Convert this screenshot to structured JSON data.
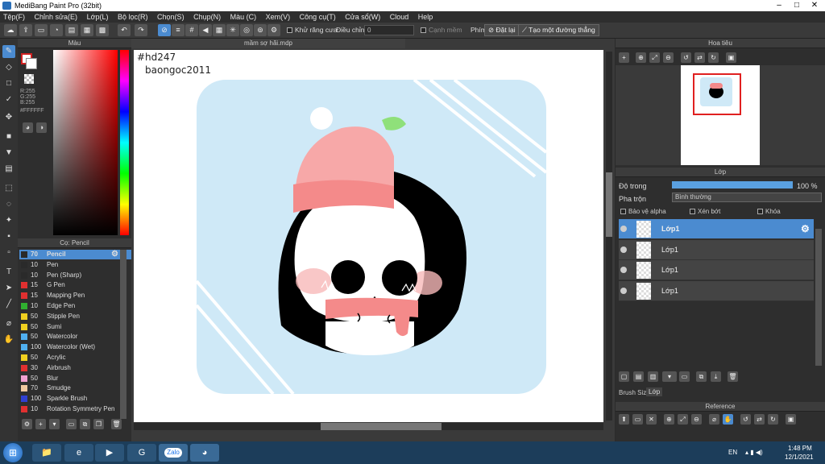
{
  "window": {
    "title": "MediBang Paint Pro (32bit)"
  },
  "menu": [
    "Tệp(F)",
    "Chỉnh sửa(E)",
    "Lớp(L)",
    "Bộ lọc(R)",
    "Chọn(S)",
    "Chụp(N)",
    "Màu (C)",
    "Xem(V)",
    "Công cụ(T)",
    "Cửa sổ(W)",
    "Cloud",
    "Help"
  ],
  "toolbar": {
    "antialias_label": "Khử răng cưa",
    "correction_label": "Điều chỉnh",
    "correction_value": "0",
    "sharp_label": "Cạnh mềm",
    "key_label": "Phím",
    "reset_label": "Đặt lại",
    "straight_label": "Tạo một đường thẳng"
  },
  "color_panel": {
    "title": "Màu",
    "r": "R:255",
    "g": "G:255",
    "b": "B:255",
    "hex": "#FFFFFF"
  },
  "brush_panel": {
    "title": "Cọ: Pencil",
    "items": [
      {
        "size": "70",
        "name": "Pencil",
        "color": "#2a2a2a"
      },
      {
        "size": "10",
        "name": "Pen",
        "color": "#2a2a2a"
      },
      {
        "size": "10",
        "name": "Pen (Sharp)",
        "color": "#2a2a2a"
      },
      {
        "size": "15",
        "name": "G Pen",
        "color": "#e03030"
      },
      {
        "size": "15",
        "name": "Mapping Pen",
        "color": "#e03030"
      },
      {
        "size": "10",
        "name": "Edge Pen",
        "color": "#30b030"
      },
      {
        "size": "50",
        "name": "Stipple Pen",
        "color": "#f0d020"
      },
      {
        "size": "50",
        "name": "Sumi",
        "color": "#f0d020"
      },
      {
        "size": "50",
        "name": "Watercolor",
        "color": "#50b0f0"
      },
      {
        "size": "100",
        "name": "Watercolor (Wet)",
        "color": "#50b0f0"
      },
      {
        "size": "50",
        "name": "Acrylic",
        "color": "#f0d020"
      },
      {
        "size": "30",
        "name": "Airbrush",
        "color": "#e03030"
      },
      {
        "size": "50",
        "name": "Blur",
        "color": "#f0a0d0"
      },
      {
        "size": "70",
        "name": "Smudge",
        "color": "#f0c8a0"
      },
      {
        "size": "100",
        "name": "Sparkle Brush",
        "color": "#3040d0"
      },
      {
        "size": "10",
        "name": "Rotation Symmetry Pen",
        "color": "#e03030"
      }
    ]
  },
  "document": {
    "tab": "mầm sợ hãi.mdp",
    "tag": "#hd247",
    "author": "baongoc2011"
  },
  "navigator": {
    "title": "Hoa tiêu"
  },
  "layers": {
    "title": "Lớp",
    "opacity_label": "Độ trong",
    "opacity_value": "100 %",
    "opacity": 1.0,
    "blend_label": "Pha trộn",
    "blend_value": "Bình thường",
    "protect_alpha": "Bảo vệ alpha",
    "clipping": "Xén bớt",
    "lock": "Khóa",
    "items": [
      "Lớp1",
      "Lớp1",
      "Lớp1",
      "Lớp1"
    ],
    "brush_size_tab": "Brush Size",
    "layer_tab": "Lớp"
  },
  "reference": {
    "title": "Reference"
  },
  "taskbar": {
    "lang": "EN",
    "time": "1:48 PM",
    "date": "12/1/2021",
    "zalo": "Zalo"
  },
  "colors": {
    "accent": "#4b8bd0",
    "panel": "#2e2e2e",
    "sky": "#cfe9f7",
    "hat": "#f48a8a"
  }
}
